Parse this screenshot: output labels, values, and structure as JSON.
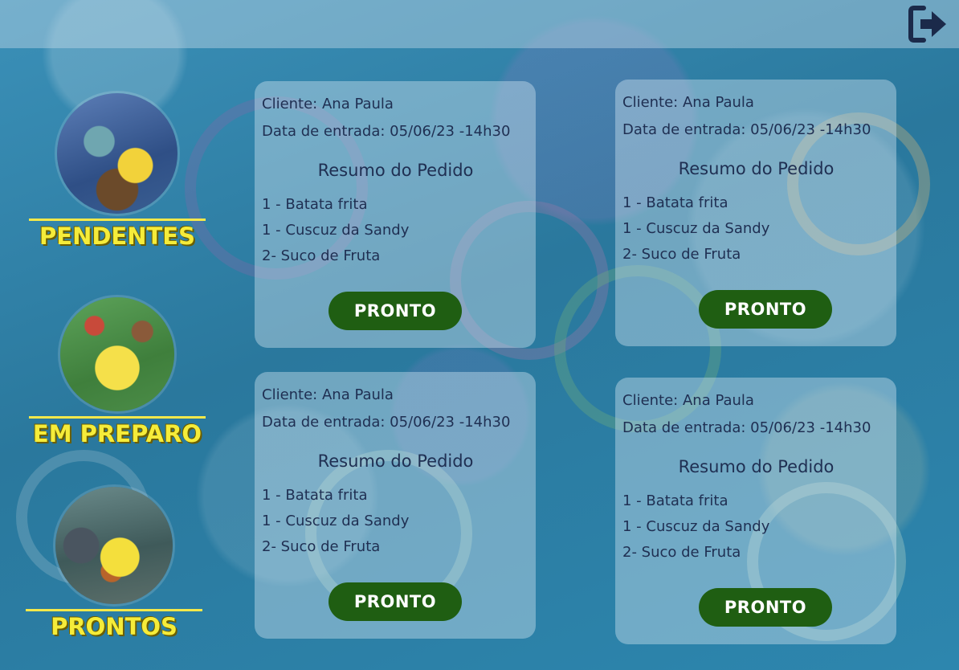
{
  "header": {
    "logout_icon": "logout-icon"
  },
  "sidebar": {
    "items": [
      {
        "label": "PENDENTES",
        "icon": "kitchen-scene-avatar"
      },
      {
        "label": "EM PREPARO",
        "icon": "cooking-avatar"
      },
      {
        "label": "PRONTOS",
        "icon": "ready-burger-avatar"
      }
    ]
  },
  "orders": [
    {
      "client": "Cliente: Ana Paula",
      "date": "Data de entrada: 05/06/23 -14h30",
      "summary_title": "Resumo do Pedido",
      "items": [
        "1 - Batata frita",
        "1 - Cuscuz da Sandy",
        "2- Suco de Fruta"
      ],
      "button_label": "PRONTO"
    },
    {
      "client": "Cliente: Ana Paula",
      "date": "Data de entrada: 05/06/23 -14h30",
      "summary_title": "Resumo do Pedido",
      "items": [
        "1 - Batata frita",
        "1 - Cuscuz da Sandy",
        "2- Suco de Fruta"
      ],
      "button_label": "PRONTO"
    },
    {
      "client": "Cliente: Ana Paula",
      "date": "Data de entrada: 05/06/23 -14h30",
      "summary_title": "Resumo do Pedido",
      "items": [
        "1 - Batata frita",
        "1 - Cuscuz da Sandy",
        "2- Suco de Fruta"
      ],
      "button_label": "PRONTO"
    },
    {
      "client": "Cliente: Ana Paula",
      "date": "Data de entrada: 05/06/23 -14h30",
      "summary_title": "Resumo do Pedido",
      "items": [
        "1 - Batata frita",
        "1 - Cuscuz da Sandy",
        "2- Suco de Fruta"
      ],
      "button_label": "PRONTO"
    }
  ],
  "colors": {
    "accent_yellow": "#f5ec3a",
    "button_green": "#1f5e12",
    "text_navy": "#1f2f52"
  }
}
